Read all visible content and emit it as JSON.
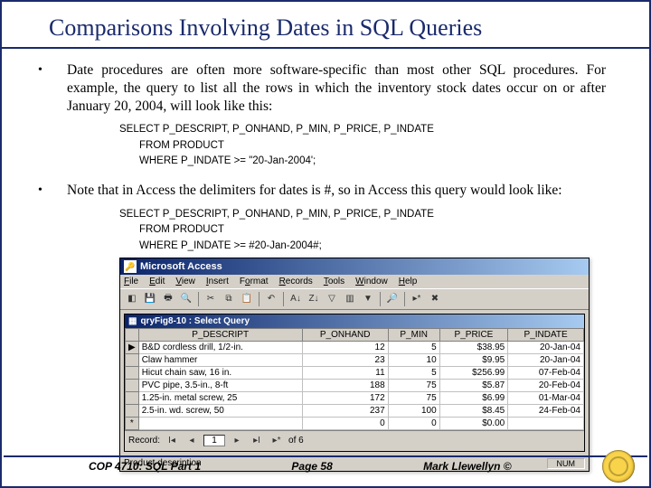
{
  "title": "Comparisons Involving Dates in SQL Queries",
  "bullets": [
    {
      "text": "Date procedures are often more software-specific than most other SQL procedures. For example, the query to list all the rows in which the inventory stock dates occur on or after January 20, 2004, will look like this:"
    },
    {
      "text": "Note that in Access the delimiters for dates is #, so in Access this query would look like:"
    }
  ],
  "code1": {
    "l1": "SELECT  P_DESCRIPT, P_ONHAND, P_MIN, P_PRICE, P_INDATE",
    "l2": "FROM PRODUCT",
    "l3": "WHERE P_INDATE >= \"20-Jan-2004';"
  },
  "code2": {
    "l1": "SELECT  P_DESCRIPT, P_ONHAND, P_MIN, P_PRICE, P_INDATE",
    "l2": "FROM PRODUCT",
    "l3": "WHERE P_INDATE >= #20-Jan-2004#;"
  },
  "access": {
    "app_title": "Microsoft Access",
    "menus": [
      "File",
      "Edit",
      "View",
      "Insert",
      "Format",
      "Records",
      "Tools",
      "Window",
      "Help"
    ],
    "menu_underline": [
      0,
      0,
      0,
      0,
      1,
      0,
      0,
      0,
      0
    ],
    "inner_title": "qryFig8-10 : Select Query",
    "columns": [
      "P_DESCRIPT",
      "P_ONHAND",
      "P_MIN",
      "P_PRICE",
      "P_INDATE"
    ],
    "rows": [
      {
        "sel": "▶",
        "d": "B&D cordless drill, 1/2-in.",
        "on": "12",
        "min": "5",
        "price": "$38.95",
        "date": "20-Jan-04"
      },
      {
        "sel": "",
        "d": "Claw hammer",
        "on": "23",
        "min": "10",
        "price": "$9.95",
        "date": "20-Jan-04"
      },
      {
        "sel": "",
        "d": "Hicut chain saw, 16 in.",
        "on": "11",
        "min": "5",
        "price": "$256.99",
        "date": "07-Feb-04"
      },
      {
        "sel": "",
        "d": "PVC pipe, 3.5-in., 8-ft",
        "on": "188",
        "min": "75",
        "price": "$5.87",
        "date": "20-Feb-04"
      },
      {
        "sel": "",
        "d": "1.25-in. metal screw, 25",
        "on": "172",
        "min": "75",
        "price": "$6.99",
        "date": "01-Mar-04"
      },
      {
        "sel": "",
        "d": "2.5-in. wd. screw, 50",
        "on": "237",
        "min": "100",
        "price": "$8.45",
        "date": "24-Feb-04"
      },
      {
        "sel": "*",
        "d": "",
        "on": "0",
        "min": "0",
        "price": "$0.00",
        "date": ""
      }
    ],
    "record_label": "Record:",
    "record_pos": "1",
    "record_of": "of 6",
    "status_left": "Product description",
    "status_right": "NUM"
  },
  "footer": {
    "left": "COP 4710: SQL Part 1",
    "center": "Page 58",
    "right": "Mark Llewellyn ©"
  }
}
